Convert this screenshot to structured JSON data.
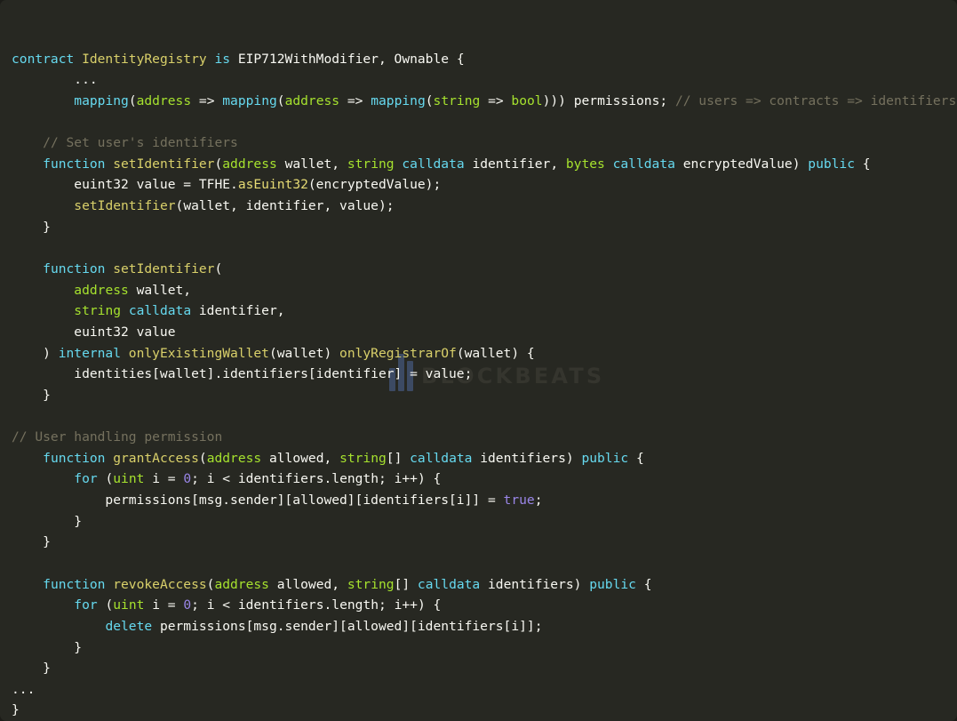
{
  "window": {
    "background_color": "#272822",
    "kind": "code-screenshot",
    "language": "Solidity"
  },
  "theme": {
    "background": "#272822",
    "plain": "#f8f8f2",
    "keyword": "#66d9ef",
    "type": "#a6e22e",
    "function_name": "#d9d06a",
    "comment": "#75715e",
    "literal": "#9a86e8",
    "member_call": "#e6db74"
  },
  "watermark": {
    "text": "BLOCKBEATS",
    "logo_name": "bar-chart-logo",
    "color": "#35352e",
    "logo_color": "#3c4a63"
  },
  "code": {
    "lines": [
      {
        "id": "line-1",
        "tokens": [
          {
            "t": "contract ",
            "c": "kw"
          },
          {
            "t": "IdentityRegistry ",
            "c": "fn"
          },
          {
            "t": "is ",
            "c": "kw"
          },
          {
            "t": "EIP712WithModifier, Ownable {",
            "c": "pln"
          }
        ]
      },
      {
        "id": "line-2",
        "tokens": [
          {
            "t": "        ...",
            "c": "pln"
          }
        ]
      },
      {
        "id": "line-3",
        "tokens": [
          {
            "t": "        ",
            "c": "pln"
          },
          {
            "t": "mapping",
            "c": "kw"
          },
          {
            "t": "(",
            "c": "pln"
          },
          {
            "t": "address ",
            "c": "typ"
          },
          {
            "t": "=> ",
            "c": "pln"
          },
          {
            "t": "mapping",
            "c": "kw"
          },
          {
            "t": "(",
            "c": "pln"
          },
          {
            "t": "address ",
            "c": "typ"
          },
          {
            "t": "=> ",
            "c": "pln"
          },
          {
            "t": "mapping",
            "c": "kw"
          },
          {
            "t": "(",
            "c": "pln"
          },
          {
            "t": "string ",
            "c": "typ"
          },
          {
            "t": "=> ",
            "c": "pln"
          },
          {
            "t": "bool",
            "c": "typ"
          },
          {
            "t": "))) permissions; ",
            "c": "pln"
          },
          {
            "t": "// users => contracts => identifiers => permission",
            "c": "cmt"
          }
        ]
      },
      {
        "id": "line-4",
        "tokens": []
      },
      {
        "id": "line-5",
        "tokens": [
          {
            "t": "    ",
            "c": "pln"
          },
          {
            "t": "// Set user's identifiers",
            "c": "cmt"
          }
        ]
      },
      {
        "id": "line-6",
        "tokens": [
          {
            "t": "    ",
            "c": "pln"
          },
          {
            "t": "function ",
            "c": "kw"
          },
          {
            "t": "setIdentifier",
            "c": "fn"
          },
          {
            "t": "(",
            "c": "pln"
          },
          {
            "t": "address ",
            "c": "typ"
          },
          {
            "t": "wallet, ",
            "c": "pln"
          },
          {
            "t": "string ",
            "c": "typ"
          },
          {
            "t": "calldata ",
            "c": "kw"
          },
          {
            "t": "identifier, ",
            "c": "pln"
          },
          {
            "t": "bytes ",
            "c": "typ"
          },
          {
            "t": "calldata ",
            "c": "kw"
          },
          {
            "t": "encryptedValue) ",
            "c": "pln"
          },
          {
            "t": "public ",
            "c": "kw"
          },
          {
            "t": "{",
            "c": "pln"
          }
        ]
      },
      {
        "id": "line-7",
        "tokens": [
          {
            "t": "        euint32 value = TFHE.",
            "c": "pln"
          },
          {
            "t": "asEuint32",
            "c": "mem"
          },
          {
            "t": "(encryptedValue);",
            "c": "pln"
          }
        ]
      },
      {
        "id": "line-8",
        "tokens": [
          {
            "t": "        ",
            "c": "pln"
          },
          {
            "t": "setIdentifier",
            "c": "fn"
          },
          {
            "t": "(wallet, identifier, value);",
            "c": "pln"
          }
        ]
      },
      {
        "id": "line-9",
        "tokens": [
          {
            "t": "    }",
            "c": "pln"
          }
        ]
      },
      {
        "id": "line-10",
        "tokens": []
      },
      {
        "id": "line-11",
        "tokens": [
          {
            "t": "    ",
            "c": "pln"
          },
          {
            "t": "function ",
            "c": "kw"
          },
          {
            "t": "setIdentifier",
            "c": "fn"
          },
          {
            "t": "(",
            "c": "pln"
          }
        ]
      },
      {
        "id": "line-12",
        "tokens": [
          {
            "t": "        ",
            "c": "pln"
          },
          {
            "t": "address ",
            "c": "typ"
          },
          {
            "t": "wallet,",
            "c": "pln"
          }
        ]
      },
      {
        "id": "line-13",
        "tokens": [
          {
            "t": "        ",
            "c": "pln"
          },
          {
            "t": "string ",
            "c": "typ"
          },
          {
            "t": "calldata ",
            "c": "kw"
          },
          {
            "t": "identifier,",
            "c": "pln"
          }
        ]
      },
      {
        "id": "line-14",
        "tokens": [
          {
            "t": "        euint32 value",
            "c": "pln"
          }
        ]
      },
      {
        "id": "line-15",
        "tokens": [
          {
            "t": "    ) ",
            "c": "pln"
          },
          {
            "t": "internal ",
            "c": "kw"
          },
          {
            "t": "onlyExistingWallet",
            "c": "fn"
          },
          {
            "t": "(wallet) ",
            "c": "pln"
          },
          {
            "t": "onlyRegistrarOf",
            "c": "fn"
          },
          {
            "t": "(wallet) {",
            "c": "pln"
          }
        ]
      },
      {
        "id": "line-16",
        "tokens": [
          {
            "t": "        identities[wallet].identifiers[identifier] = value;",
            "c": "pln"
          }
        ]
      },
      {
        "id": "line-17",
        "tokens": [
          {
            "t": "    }",
            "c": "pln"
          }
        ]
      },
      {
        "id": "line-18",
        "tokens": []
      },
      {
        "id": "line-19",
        "tokens": [
          {
            "t": "// User handling permission",
            "c": "cmt"
          }
        ]
      },
      {
        "id": "line-20",
        "tokens": [
          {
            "t": "    ",
            "c": "pln"
          },
          {
            "t": "function ",
            "c": "kw"
          },
          {
            "t": "grantAccess",
            "c": "fn"
          },
          {
            "t": "(",
            "c": "pln"
          },
          {
            "t": "address ",
            "c": "typ"
          },
          {
            "t": "allowed, ",
            "c": "pln"
          },
          {
            "t": "string",
            "c": "typ"
          },
          {
            "t": "[] ",
            "c": "pln"
          },
          {
            "t": "calldata ",
            "c": "kw"
          },
          {
            "t": "identifiers) ",
            "c": "pln"
          },
          {
            "t": "public ",
            "c": "kw"
          },
          {
            "t": "{",
            "c": "pln"
          }
        ]
      },
      {
        "id": "line-21",
        "tokens": [
          {
            "t": "        ",
            "c": "pln"
          },
          {
            "t": "for ",
            "c": "kw"
          },
          {
            "t": "(",
            "c": "pln"
          },
          {
            "t": "uint ",
            "c": "typ"
          },
          {
            "t": "i = ",
            "c": "pln"
          },
          {
            "t": "0",
            "c": "num"
          },
          {
            "t": "; i < identifiers.length; i++) {",
            "c": "pln"
          }
        ]
      },
      {
        "id": "line-22",
        "tokens": [
          {
            "t": "            permissions[msg.sender][allowed][identifiers[i]] = ",
            "c": "pln"
          },
          {
            "t": "true",
            "c": "num"
          },
          {
            "t": ";",
            "c": "pln"
          }
        ]
      },
      {
        "id": "line-23",
        "tokens": [
          {
            "t": "        }",
            "c": "pln"
          }
        ]
      },
      {
        "id": "line-24",
        "tokens": [
          {
            "t": "    }",
            "c": "pln"
          }
        ]
      },
      {
        "id": "line-25",
        "tokens": []
      },
      {
        "id": "line-26",
        "tokens": [
          {
            "t": "    ",
            "c": "pln"
          },
          {
            "t": "function ",
            "c": "kw"
          },
          {
            "t": "revokeAccess",
            "c": "fn"
          },
          {
            "t": "(",
            "c": "pln"
          },
          {
            "t": "address ",
            "c": "typ"
          },
          {
            "t": "allowed, ",
            "c": "pln"
          },
          {
            "t": "string",
            "c": "typ"
          },
          {
            "t": "[] ",
            "c": "pln"
          },
          {
            "t": "calldata ",
            "c": "kw"
          },
          {
            "t": "identifiers) ",
            "c": "pln"
          },
          {
            "t": "public ",
            "c": "kw"
          },
          {
            "t": "{",
            "c": "pln"
          }
        ]
      },
      {
        "id": "line-27",
        "tokens": [
          {
            "t": "        ",
            "c": "pln"
          },
          {
            "t": "for ",
            "c": "kw"
          },
          {
            "t": "(",
            "c": "pln"
          },
          {
            "t": "uint ",
            "c": "typ"
          },
          {
            "t": "i = ",
            "c": "pln"
          },
          {
            "t": "0",
            "c": "num"
          },
          {
            "t": "; i < identifiers.length; i++) {",
            "c": "pln"
          }
        ]
      },
      {
        "id": "line-28",
        "tokens": [
          {
            "t": "            ",
            "c": "pln"
          },
          {
            "t": "delete ",
            "c": "kw"
          },
          {
            "t": "permissions[msg.sender][allowed][identifiers[i]];",
            "c": "pln"
          }
        ]
      },
      {
        "id": "line-29",
        "tokens": [
          {
            "t": "        }",
            "c": "pln"
          }
        ]
      },
      {
        "id": "line-30",
        "tokens": [
          {
            "t": "    }",
            "c": "pln"
          }
        ]
      },
      {
        "id": "line-31",
        "tokens": [
          {
            "t": "...",
            "c": "pln"
          }
        ]
      },
      {
        "id": "line-32",
        "tokens": [
          {
            "t": "}",
            "c": "pln"
          }
        ]
      }
    ]
  }
}
